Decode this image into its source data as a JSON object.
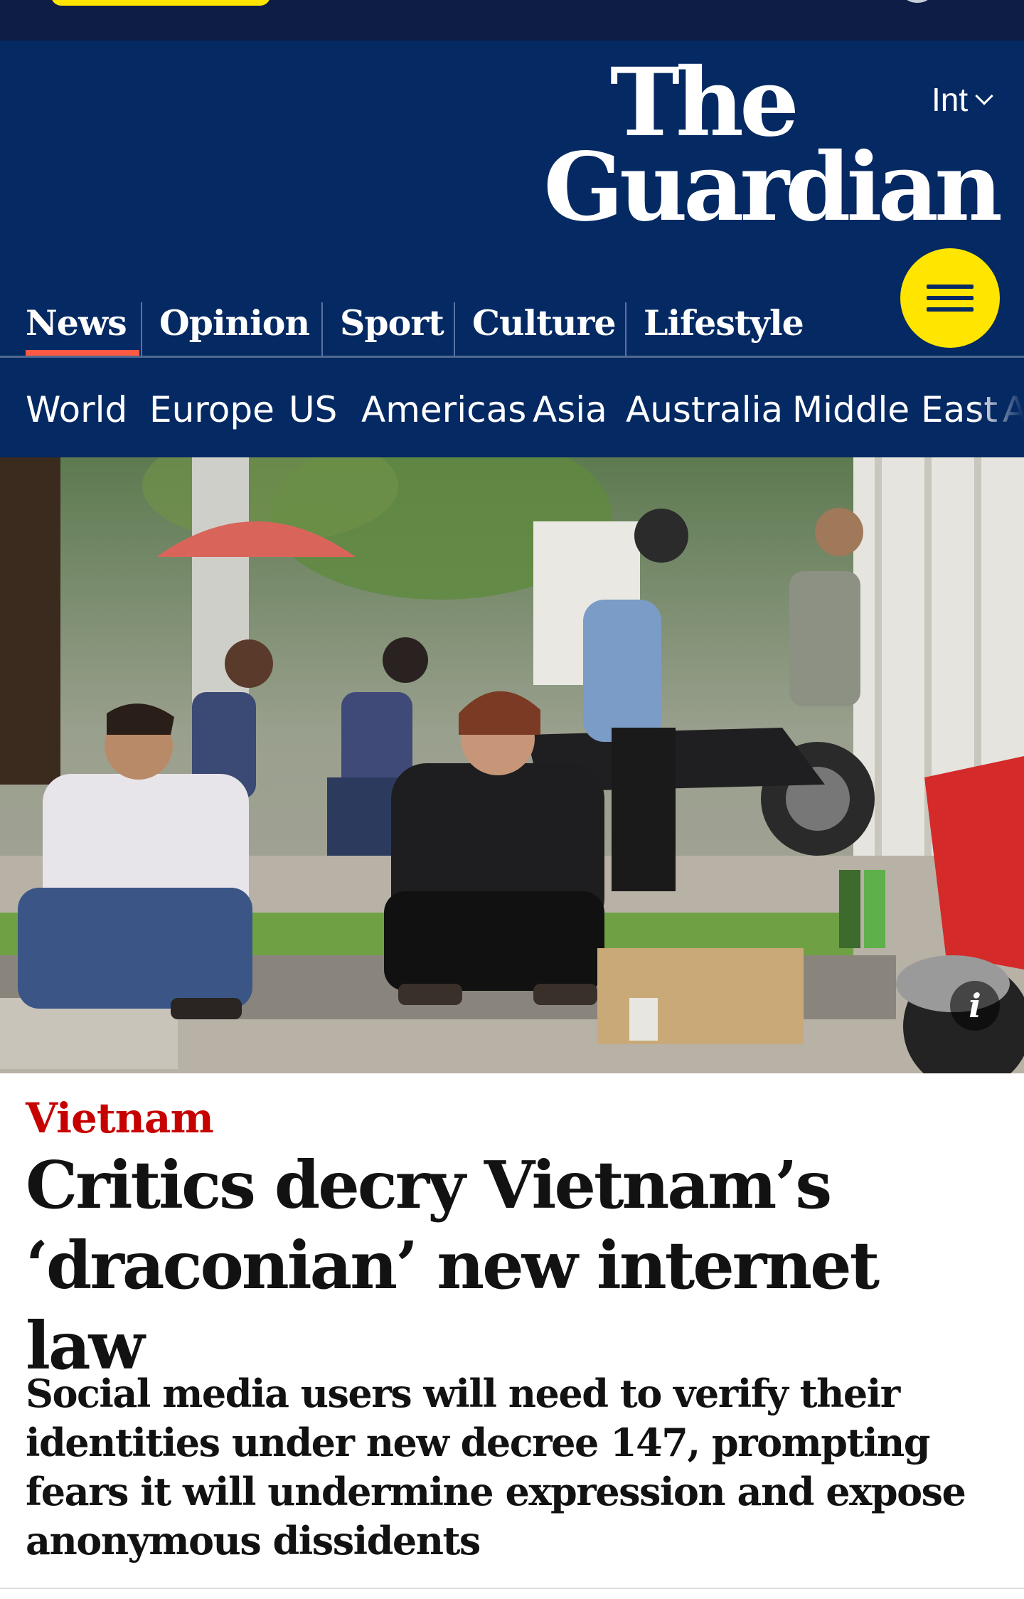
{
  "edition": {
    "label": "Int",
    "icon": "chevron-down-icon"
  },
  "logo": {
    "line1": "The",
    "line2": "Guardian"
  },
  "pillars": [
    {
      "label": "News",
      "active": true
    },
    {
      "label": "Opinion"
    },
    {
      "label": "Sport"
    },
    {
      "label": "Culture"
    },
    {
      "label": "Lifestyle"
    }
  ],
  "menu": {
    "icon": "hamburger-menu-icon"
  },
  "subnav": [
    "World",
    "Europe",
    "US",
    "Americas",
    "Asia",
    "Australia",
    "Middle East",
    "A"
  ],
  "hero": {
    "info_label": "i",
    "info_icon": "info-icon"
  },
  "article": {
    "kicker": "Vietnam",
    "headline_line1": "Critics decry Vietnam’s",
    "headline_line2": "‘draconian’ new internet law",
    "standfirst": "Social media users will need to verify their identities under new decree 147, prompting fears it will undermine expression and expose anonymous dissidents"
  },
  "colors": {
    "brand_blue": "#052962",
    "accent_yellow": "#ffe500",
    "news_red": "#ff5943",
    "kicker_red": "#c70000"
  }
}
